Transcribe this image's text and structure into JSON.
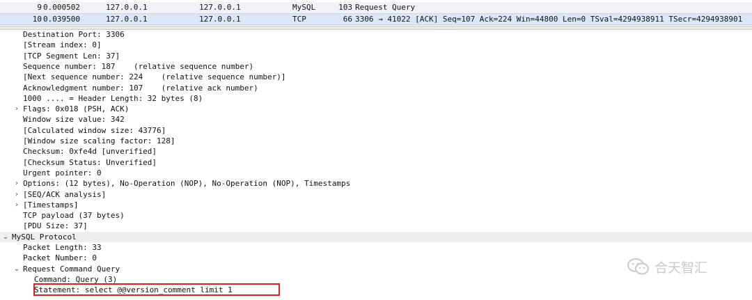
{
  "packet_list": {
    "rows": [
      {
        "no": "9",
        "time": "0.000502",
        "src": "127.0.0.1",
        "dst": "127.0.0.1",
        "proto": "MySQL",
        "len": "103",
        "info": "Request Query"
      },
      {
        "no": "10",
        "time": "0.039500",
        "src": "127.0.0.1",
        "dst": "127.0.0.1",
        "proto": "TCP",
        "len": "66",
        "info": "3306 → 41022 [ACK] Seq=107 Ack=224 Win=44800 Len=0 TSval=4294938911 TSecr=4294938901"
      }
    ]
  },
  "details": {
    "lines": [
      {
        "text": "Destination Port: 3306",
        "indent": 2,
        "expand": ""
      },
      {
        "text": "[Stream index: 0]",
        "indent": 2,
        "expand": ""
      },
      {
        "text": "[TCP Segment Len: 37]",
        "indent": 2,
        "expand": ""
      },
      {
        "text": "Sequence number: 187    (relative sequence number)",
        "indent": 2,
        "expand": ""
      },
      {
        "text": "[Next sequence number: 224    (relative sequence number)]",
        "indent": 2,
        "expand": ""
      },
      {
        "text": "Acknowledgment number: 107    (relative ack number)",
        "indent": 2,
        "expand": ""
      },
      {
        "text": "1000 .... = Header Length: 32 bytes (8)",
        "indent": 2,
        "expand": ""
      },
      {
        "text": "Flags: 0x018 (PSH, ACK)",
        "indent": 2,
        "expand": "collapsed"
      },
      {
        "text": "Window size value: 342",
        "indent": 2,
        "expand": ""
      },
      {
        "text": "[Calculated window size: 43776]",
        "indent": 2,
        "expand": ""
      },
      {
        "text": "[Window size scaling factor: 128]",
        "indent": 2,
        "expand": ""
      },
      {
        "text": "Checksum: 0xfe4d [unverified]",
        "indent": 2,
        "expand": ""
      },
      {
        "text": "[Checksum Status: Unverified]",
        "indent": 2,
        "expand": ""
      },
      {
        "text": "Urgent pointer: 0",
        "indent": 2,
        "expand": ""
      },
      {
        "text": "Options: (12 bytes), No-Operation (NOP), No-Operation (NOP), Timestamps",
        "indent": 2,
        "expand": "collapsed"
      },
      {
        "text": "[SEQ/ACK analysis]",
        "indent": 2,
        "expand": "collapsed"
      },
      {
        "text": "[Timestamps]",
        "indent": 2,
        "expand": "collapsed"
      },
      {
        "text": "TCP payload (37 bytes)",
        "indent": 2,
        "expand": ""
      },
      {
        "text": "[PDU Size: 37]",
        "indent": 2,
        "expand": ""
      },
      {
        "text": "MySQL Protocol",
        "indent": 1,
        "expand": "expanded",
        "shaded": true
      },
      {
        "text": "Packet Length: 33",
        "indent": 2,
        "expand": ""
      },
      {
        "text": "Packet Number: 0",
        "indent": 2,
        "expand": ""
      },
      {
        "text": "Request Command Query",
        "indent": 2,
        "expand": "expanded"
      },
      {
        "text": "Command: Query (3)",
        "indent": 3,
        "expand": ""
      },
      {
        "text": "Statement: select @@version_comment limit 1",
        "indent": 3,
        "expand": ""
      }
    ]
  },
  "icons": {
    "collapsed": "chevron-right-icon",
    "expanded": "chevron-down-icon"
  },
  "colors": {
    "selected_row": "#dbe7f8",
    "highlight_border": "#e02020",
    "watermark": "#c9c9c9"
  },
  "watermark": {
    "text": "合天智汇"
  }
}
